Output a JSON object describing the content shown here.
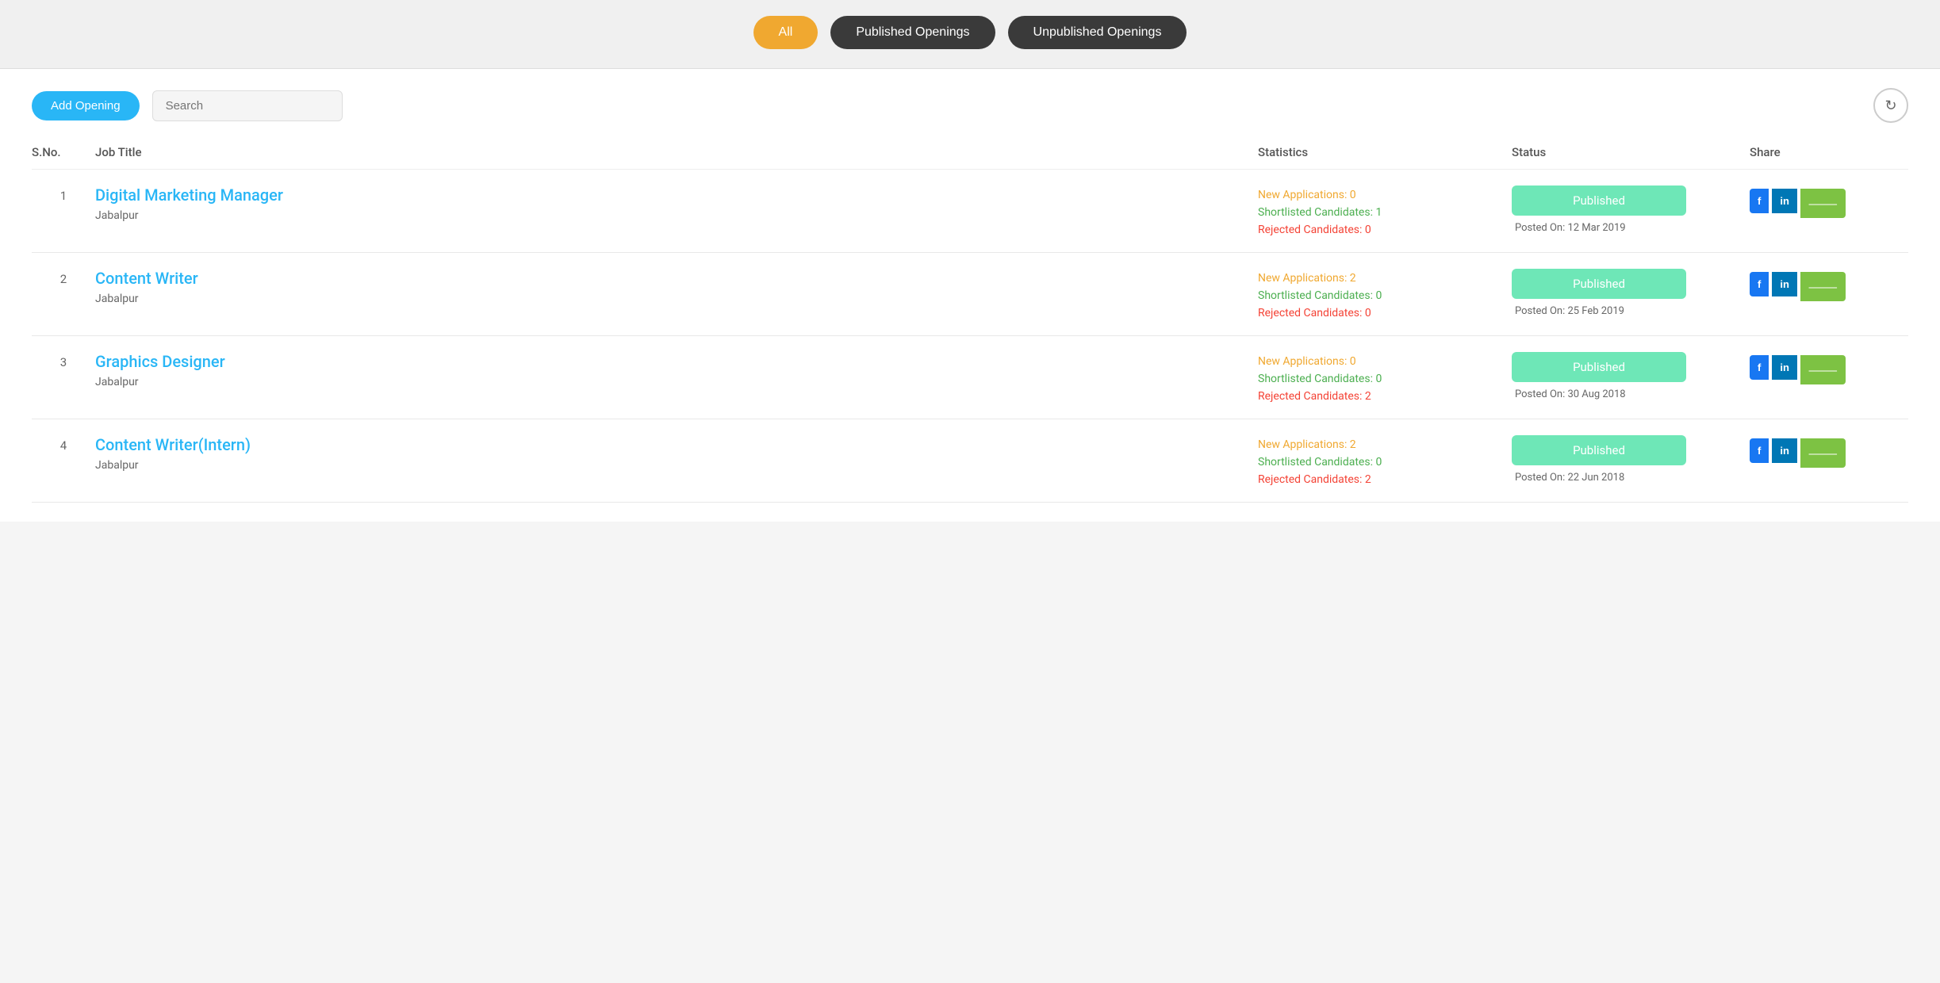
{
  "filters": {
    "all_label": "All",
    "published_label": "Published Openings",
    "unpublished_label": "Unpublished Openings"
  },
  "toolbar": {
    "add_button_label": "Add Opening",
    "search_placeholder": "Search",
    "refresh_icon": "↻"
  },
  "table": {
    "headers": {
      "sno": "S.No.",
      "job_title": "Job Title",
      "statistics": "Statistics",
      "status": "Status",
      "share": "Share"
    },
    "rows": [
      {
        "sno": "1",
        "title": "Digital Marketing Manager",
        "location": "Jabalpur",
        "new_applications": "New Applications: 0",
        "shortlisted": "Shortlisted Candidates: 1",
        "rejected": "Rejected Candidates: 0",
        "status": "Published",
        "posted_on": "Posted On: 12 Mar 2019"
      },
      {
        "sno": "2",
        "title": "Content Writer",
        "location": "Jabalpur",
        "new_applications": "New Applications: 2",
        "shortlisted": "Shortlisted Candidates: 0",
        "rejected": "Rejected Candidates: 0",
        "status": "Published",
        "posted_on": "Posted On: 25 Feb 2019"
      },
      {
        "sno": "3",
        "title": "Graphics Designer",
        "location": "Jabalpur",
        "new_applications": "New Applications: 0",
        "shortlisted": "Shortlisted Candidates: 0",
        "rejected": "Rejected Candidates: 2",
        "status": "Published",
        "posted_on": "Posted On: 30 Aug 2018"
      },
      {
        "sno": "4",
        "title": "Content Writer(Intern)",
        "location": "Jabalpur",
        "new_applications": "New Applications: 2",
        "shortlisted": "Shortlisted Candidates: 0",
        "rejected": "Rejected Candidates: 2",
        "status": "Published",
        "posted_on": "Posted On: 22 Jun 2018"
      }
    ]
  },
  "share_buttons": {
    "facebook": "f",
    "linkedin": "in",
    "more": "⋈"
  }
}
